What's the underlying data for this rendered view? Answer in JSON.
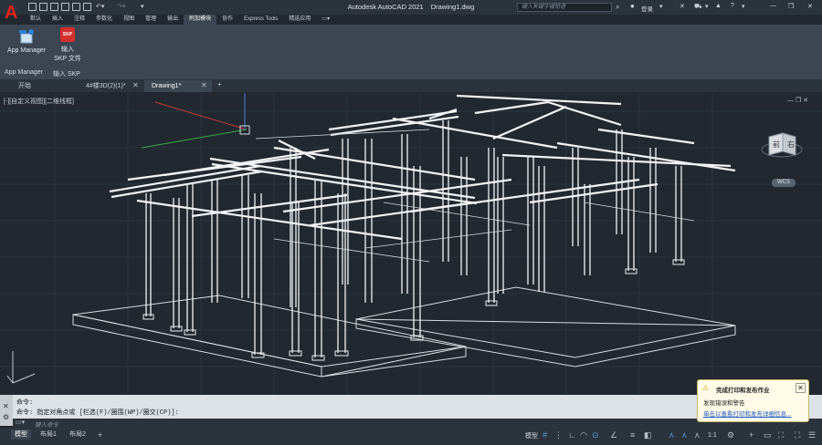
{
  "app": {
    "logo_letter": "A",
    "product": "Autodesk AutoCAD 2021",
    "document": "Drawing1.dwg",
    "search_placeholder": "键入关键字或短语",
    "login_label": "登录"
  },
  "menu_tabs": [
    {
      "label": "默认"
    },
    {
      "label": "插入"
    },
    {
      "label": "注释"
    },
    {
      "label": "参数化"
    },
    {
      "label": "视图"
    },
    {
      "label": "管理"
    },
    {
      "label": "输出"
    },
    {
      "label": "附加模块"
    },
    {
      "label": "协作"
    },
    {
      "label": "Express Tools"
    },
    {
      "label": "精选应用"
    },
    {
      "label": "▭▾"
    }
  ],
  "ribbon": {
    "app_manager_label": "App Manager",
    "import_skp_line1": "输入",
    "import_skp_line2": "SKP 文件",
    "skp_icon_text": "SKP",
    "panel_app_manager": "App Manager",
    "panel_import_skp": "输入 SKP"
  },
  "file_tabs": [
    {
      "label": "开始"
    },
    {
      "label": "4#楼3D(2)(1)*"
    },
    {
      "label": "Drawing1*"
    }
  ],
  "viewport": {
    "label": "[-][自定义视图][二维线框]",
    "cube_face_left": "前",
    "cube_face_right": "右",
    "wcs_label": "WCS"
  },
  "command": {
    "line1": "命令:",
    "line2": "命令: 指定对角点或 [栏选(F)/圈围(WP)/圈交(CP)]:",
    "input_placeholder": "键入命令"
  },
  "status": {
    "layout_tabs": [
      {
        "label": "模型"
      },
      {
        "label": "布局1"
      },
      {
        "label": "布局2"
      }
    ],
    "model_label": "模型",
    "scale_label": "1:1"
  },
  "notification": {
    "title": "完成打印和发布作业",
    "line1": "发现错误和警告",
    "link": "单击以查看打印和发布详细信息..."
  },
  "colors": {
    "accent": "#e2231a",
    "background": "#212830",
    "grid_line": "#2f3a45",
    "model_lines": "#f2f4f6"
  }
}
